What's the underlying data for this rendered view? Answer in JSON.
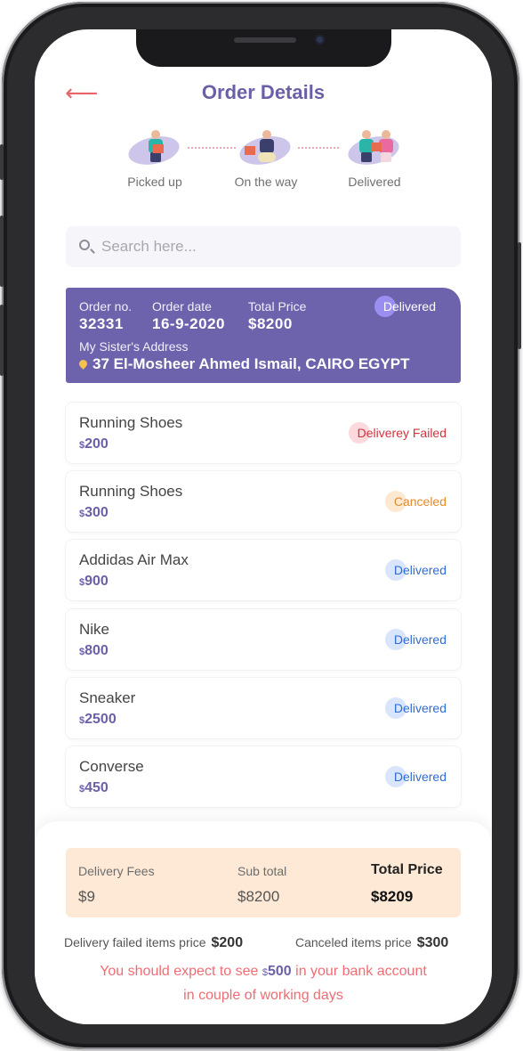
{
  "header": {
    "title": "Order Details",
    "back_icon": "arrow-left-icon",
    "accent": "#6b5fa8",
    "back_color": "#e8636a"
  },
  "steps": [
    {
      "label": "Picked up",
      "icon": "courier-pickup-icon"
    },
    {
      "label": "On the way",
      "icon": "scooter-delivery-icon"
    },
    {
      "label": "Delivered",
      "icon": "handover-icon"
    }
  ],
  "search": {
    "placeholder": "Search here...",
    "value": "",
    "icon": "search-icon"
  },
  "order": {
    "number_label": "Order no.",
    "number": "32331",
    "date_label": "Order date",
    "date": "16-9-2020",
    "total_label": "Total Price",
    "total": "$8200",
    "status": "Delivered",
    "address_label": "My Sister's Address",
    "address": "37 El-Mosheer Ahmed Ismail, CAIRO EGYPT",
    "card_color": "#6d63ac"
  },
  "items": [
    {
      "name": "Running Shoes",
      "currency": "$",
      "price": "200",
      "status": "Deliverey Failed"
    },
    {
      "name": "Running Shoes",
      "currency": "$",
      "price": "300",
      "status": "Canceled"
    },
    {
      "name": "Addidas Air Max",
      "currency": "$",
      "price": "900",
      "status": "Delivered"
    },
    {
      "name": "Nike",
      "currency": "$",
      "price": "800",
      "status": "Delivered"
    },
    {
      "name": "Sneaker",
      "currency": "$",
      "price": "2500",
      "status": "Delivered"
    },
    {
      "name": "Converse",
      "currency": "$",
      "price": "450",
      "status": "Delivered"
    }
  ],
  "status_colors": {
    "failed": "#d0343f",
    "canceled": "#e48a27",
    "delivered": "#2f6cd6"
  },
  "totals": {
    "fees_label": "Delivery Fees",
    "fees": "$9",
    "subtotal_label": "Sub total",
    "subtotal": "$8200",
    "total_label": "Total Price",
    "total": "$8209"
  },
  "extras": {
    "failed_label": "Delivery failed items price",
    "failed_value": "$200",
    "canceled_label": "Canceled items price",
    "canceled_value": "$300"
  },
  "note": {
    "line1_before": "You should expect to see ",
    "currency": "$",
    "amount": "500",
    "line1_after": " in your bank account",
    "line2": "in couple of working days"
  }
}
